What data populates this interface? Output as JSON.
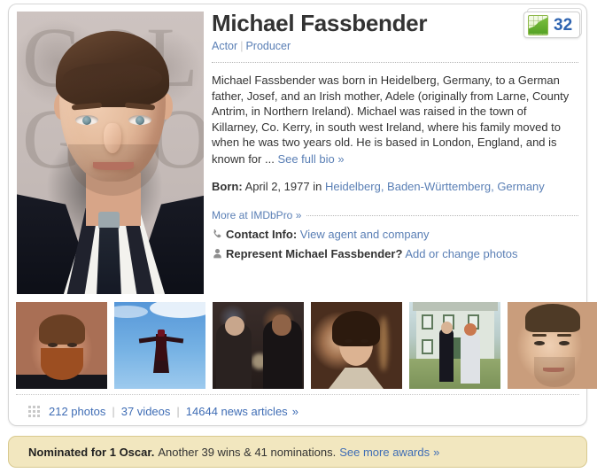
{
  "person": {
    "name": "Michael Fassbender",
    "job_categories": [
      "Actor",
      "Producer"
    ],
    "job_separator": "|"
  },
  "star_meter": {
    "value": "32",
    "icon": "star-meter-chart-icon"
  },
  "bio": {
    "text": "Michael Fassbender was born in Heidelberg, Germany, to a German father, Josef, and an Irish mother, Adele (originally from Larne, County Antrim, in Northern Ireland). Michael was raised in the town of Killarney, Co. Kerry, in south west Ireland, where his family moved to when he was two years old. He is based in London, England, and is known for ...",
    "see_full_bio": "See full bio »"
  },
  "born": {
    "label": "Born:",
    "date": "April 2, 1977",
    "preposition": "in",
    "place": "Heidelberg, Baden-Württemberg, Germany"
  },
  "pro": {
    "more_at_imdbpro": "More at IMDbPro »",
    "contact_label": "Contact Info:",
    "contact_link": "View agent and company",
    "represent_label": "Represent Michael Fassbender?",
    "represent_link": "Add or change photos"
  },
  "photo_strip": [
    {
      "caption": "Michael Fassbender red carpet beard portrait"
    },
    {
      "caption": "Magneto flying against blue sky"
    },
    {
      "caption": "Dark night street scene with two people"
    },
    {
      "caption": "Period drama warm-lit portrait"
    },
    {
      "caption": "Couple standing outside a country house"
    },
    {
      "caption": "Close-up portrait light background"
    }
  ],
  "media_links": {
    "photos": "212 photos",
    "videos": "37 videos",
    "news_articles": "14644 news articles",
    "separator": "|",
    "arrow": "»"
  },
  "awards": {
    "headline": "Nominated for 1 Oscar.",
    "detail": "Another 39 wins & 41 nominations.",
    "see_more": "See more awards",
    "arrow": "»"
  },
  "colors": {
    "link_blue": "#3f6db5",
    "muted_link_blue": "#5a7fb5",
    "text": "#333333",
    "award_bg": "#f2e7bf",
    "award_border": "#d8c98f",
    "star_meter_value": "#2e63b0",
    "panel_border": "#d6d6d6"
  }
}
